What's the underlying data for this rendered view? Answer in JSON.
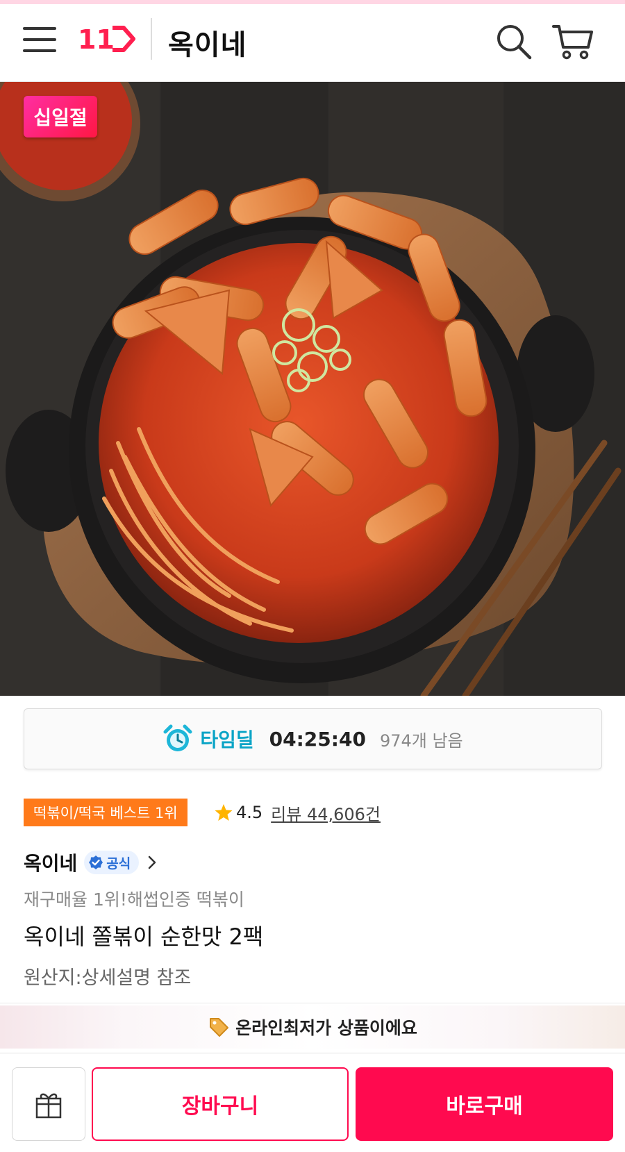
{
  "header": {
    "logo_text": "11",
    "title": "옥이네",
    "icons": [
      "menu-icon",
      "search-icon",
      "cart-icon"
    ]
  },
  "hero": {
    "sale_badge": "십일절"
  },
  "timedeal": {
    "label": "타임딜",
    "time": "04:25:40",
    "remaining": "974개 남음",
    "icon": "alarm-clock-icon"
  },
  "product": {
    "best_badge": "떡볶이/떡국 베스트 1위",
    "rating": "4.5",
    "review_link": "리뷰 44,606건",
    "store_name": "옥이네",
    "official_label": "공식",
    "subtitle": "재구매율 1위!해썹인증 떡볶이",
    "title": "옥이네 쫄볶이 순한맛 2팩",
    "origin": "원산지:상세설명 참조"
  },
  "banner": {
    "lowest_price": "온라인최저가 상품이에요"
  },
  "bottom_bar": {
    "cart_label": "장바구니",
    "buy_label": "바로구매"
  },
  "colors": {
    "brand": "#ff0a4f",
    "timedeal": "#0aa4c6",
    "best_badge": "#ff7a1a",
    "official": "#2b6fd6"
  }
}
